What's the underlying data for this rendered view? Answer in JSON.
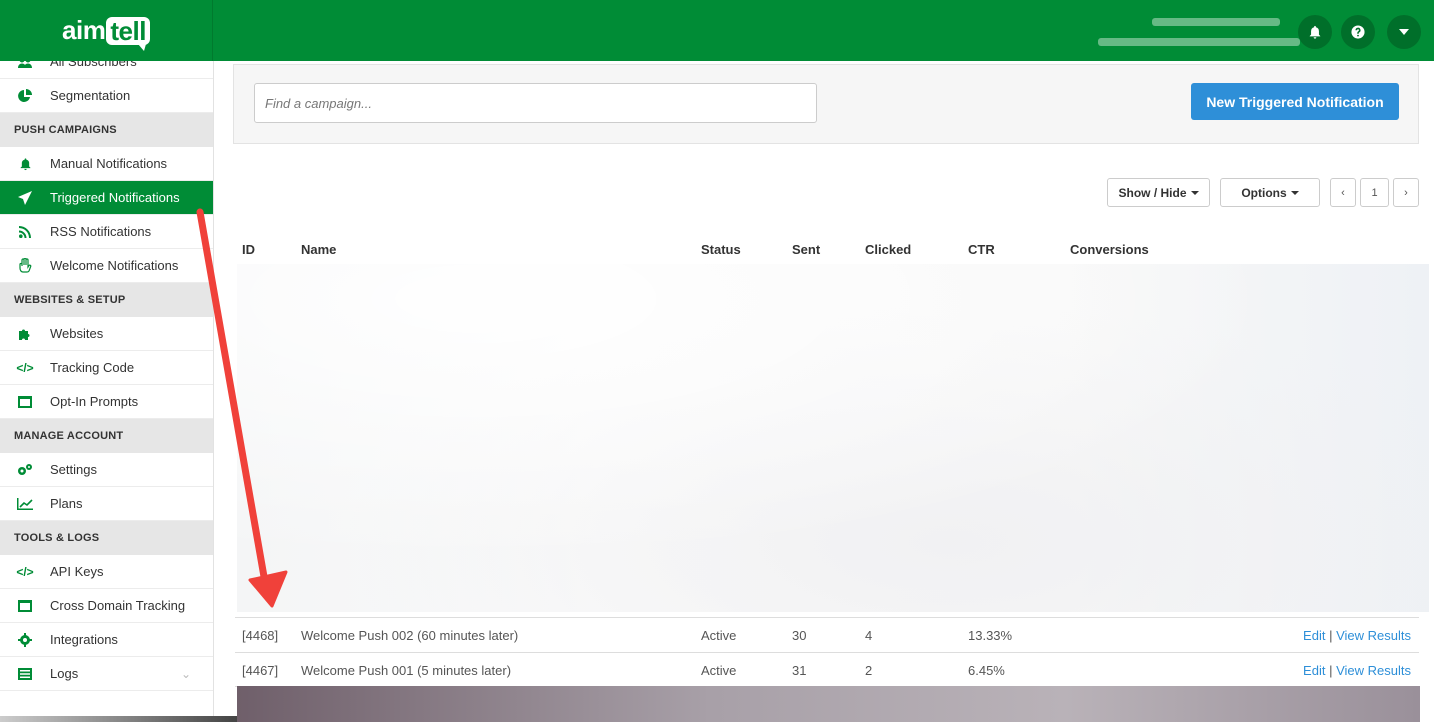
{
  "app": {
    "logo_left": "aim",
    "logo_right": "tell"
  },
  "sidebar": {
    "top_cut_item": {
      "label": "All Subscribers",
      "icon": "users-icon"
    },
    "items_before": [
      {
        "label": "Segmentation",
        "icon": "pie-chart-icon"
      }
    ],
    "sections": [
      {
        "heading": "PUSH CAMPAIGNS",
        "items": [
          {
            "label": "Manual Notifications",
            "icon": "bell-icon"
          },
          {
            "label": "Triggered Notifications",
            "icon": "paper-plane-icon",
            "active": true
          },
          {
            "label": "RSS Notifications",
            "icon": "rss-icon"
          },
          {
            "label": "Welcome Notifications",
            "icon": "hand-wave-icon"
          }
        ]
      },
      {
        "heading": "WEBSITES & SETUP",
        "items": [
          {
            "label": "Websites",
            "icon": "puzzle-icon"
          },
          {
            "label": "Tracking Code",
            "icon": "code-icon"
          },
          {
            "label": "Opt-In Prompts",
            "icon": "window-icon"
          }
        ]
      },
      {
        "heading": "MANAGE ACCOUNT",
        "items": [
          {
            "label": "Settings",
            "icon": "gears-icon"
          },
          {
            "label": "Plans",
            "icon": "line-chart-icon"
          }
        ]
      },
      {
        "heading": "TOOLS & LOGS",
        "items": [
          {
            "label": "API Keys",
            "icon": "code-icon"
          },
          {
            "label": "Cross Domain Tracking",
            "icon": "window-icon"
          },
          {
            "label": "Integrations",
            "icon": "gear-icon"
          },
          {
            "label": "Logs",
            "icon": "list-icon",
            "chevron": "⌄"
          }
        ]
      }
    ]
  },
  "toolbar": {
    "search_placeholder": "Find a campaign...",
    "new_button": "New Triggered Notification",
    "show_hide": "Show / Hide",
    "options": "Options",
    "prev": "‹",
    "page": "1",
    "next": "›"
  },
  "table": {
    "headers": [
      "ID",
      "Name",
      "Status",
      "Sent",
      "Clicked",
      "CTR",
      "Conversions"
    ],
    "rows": [
      {
        "id": "[4468]",
        "name": "Welcome Push 002 (60 minutes later)",
        "status": "Active",
        "sent": "30",
        "clicked": "4",
        "ctr": "13.33%",
        "edit": "Edit",
        "sep": "|",
        "view": "View Results"
      },
      {
        "id": "[4467]",
        "name": "Welcome Push 001 (5 minutes later)",
        "status": "Active",
        "sent": "31",
        "clicked": "2",
        "ctr": "6.45%",
        "edit": "Edit",
        "sep": "|",
        "view": "View Results"
      }
    ]
  },
  "colors": {
    "brand": "#008c36",
    "primary": "#2e8fd8",
    "annotation_arrow": "#f0413a"
  }
}
